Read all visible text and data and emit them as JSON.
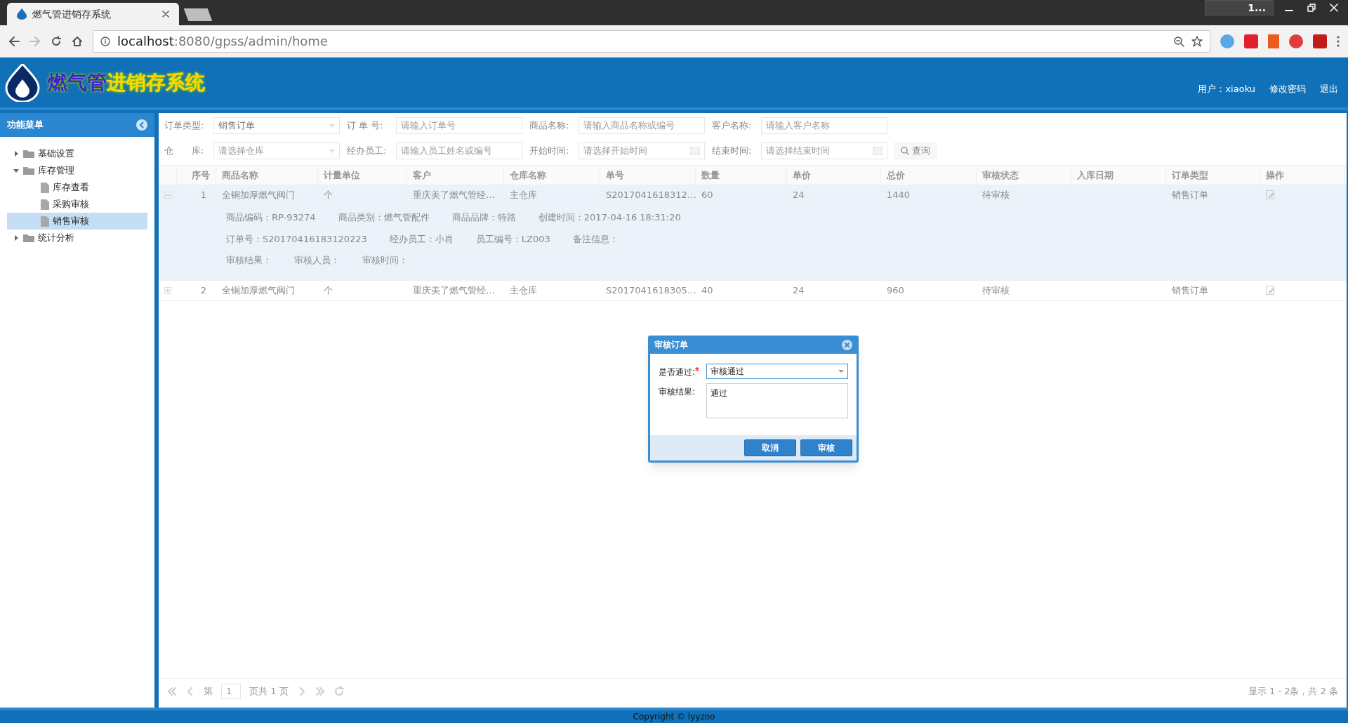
{
  "browser": {
    "tab_title": "燃气管进销存系统",
    "url_host": "localhost",
    "url_rest": ":8080/gpss/admin/home",
    "profile": "1..."
  },
  "header": {
    "title_a": "燃气管",
    "title_b": "进销存系统",
    "user": "用户：xiaoku",
    "links": [
      "修改密码",
      "退出"
    ]
  },
  "sidebar": {
    "title": "功能菜单",
    "tree": [
      {
        "label": "基础设置",
        "expanded": false,
        "selected": false
      },
      {
        "label": "库存管理",
        "expanded": true,
        "selected": false,
        "children": [
          {
            "label": "库存查看",
            "selected": false
          },
          {
            "label": "采购审核",
            "selected": false
          },
          {
            "label": "销售审核",
            "selected": true
          }
        ]
      },
      {
        "label": "统计分析",
        "expanded": false,
        "selected": false
      }
    ]
  },
  "filters": [
    [
      {
        "label": "订单类型:",
        "kind": "select",
        "value": "销售订单"
      },
      {
        "label": "订 单 号:",
        "kind": "input",
        "placeholder": "请输入订单号"
      },
      {
        "label": "商品名称:",
        "kind": "input",
        "placeholder": "请输入商品名称或编号"
      },
      {
        "label": "客户名称:",
        "kind": "input",
        "placeholder": "请输入客户名称"
      }
    ],
    [
      {
        "label": "仓　　库:",
        "kind": "select",
        "placeholder": "请选择仓库"
      },
      {
        "label": "经办员工:",
        "kind": "input",
        "placeholder": "请输入员工姓名或编号"
      },
      {
        "label": "开始时间:",
        "kind": "date",
        "placeholder": "请选择开始时间"
      },
      {
        "label": "结束时间:",
        "kind": "date",
        "placeholder": "请选择结束时间"
      }
    ]
  ],
  "search_button": "查询",
  "table": {
    "columns": [
      "序号",
      "商品名称",
      "计量单位",
      "客户",
      "仓库名称",
      "单号",
      "数量",
      "单价",
      "总价",
      "审核状态",
      "入库日期",
      "订单类型",
      "操作"
    ],
    "rows": [
      {
        "expanded": true,
        "cells": [
          "1",
          "全铜加厚燃气阀门",
          "个",
          "重庆美了燃气管经…",
          "主仓库",
          "S2017041618312…",
          "60",
          "24",
          "1440",
          "待审核",
          "",
          "销售订单"
        ],
        "details": [
          [
            "商品编码：RP-93274",
            "商品类别：燃气管配件",
            "商品品牌：特路",
            "创建时间：2017-04-16 18:31:20"
          ],
          [
            "订单号：S20170416183120223",
            "经办员工：小肖",
            "员工编号：LZ003",
            "备注信息："
          ],
          [
            "审核结果：",
            "审核人员：",
            "审核时间："
          ]
        ]
      },
      {
        "expanded": false,
        "cells": [
          "2",
          "全铜加厚燃气阀门",
          "个",
          "重庆美了燃气管经…",
          "主仓库",
          "S2017041618305…",
          "40",
          "24",
          "960",
          "待审核",
          "",
          "销售订单"
        ]
      }
    ]
  },
  "pager": {
    "page_label": "第",
    "page": "1",
    "page_total": "页共 1 页",
    "summary": "显示 1 - 2条，共 2 条"
  },
  "dialog": {
    "title": "审核订单",
    "fields": [
      {
        "label": "是否通过:",
        "required": true,
        "kind": "select",
        "value": "审核通过"
      },
      {
        "label": "审核结果:",
        "required": false,
        "kind": "textarea",
        "value": "通过"
      }
    ],
    "buttons": [
      "取消",
      "审核"
    ]
  },
  "footer": "Copyright © lyyzoo"
}
